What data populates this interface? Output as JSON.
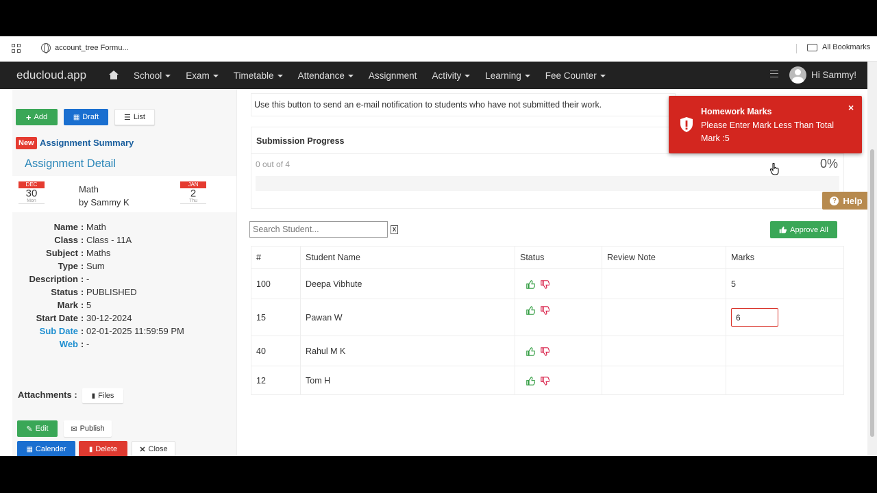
{
  "bookmarks": {
    "tab_label": "account_tree Formu...",
    "all_bookmarks": "All Bookmarks"
  },
  "navbar": {
    "brand": "educloud.app",
    "items": [
      {
        "label": "School",
        "dropdown": true
      },
      {
        "label": "Exam",
        "dropdown": true
      },
      {
        "label": "Timetable",
        "dropdown": true
      },
      {
        "label": "Attendance",
        "dropdown": true
      },
      {
        "label": "Assignment",
        "dropdown": false
      },
      {
        "label": "Activity",
        "dropdown": true
      },
      {
        "label": "Learning",
        "dropdown": true
      },
      {
        "label": "Fee Counter",
        "dropdown": true
      }
    ],
    "greeting": "Hi Sammy!"
  },
  "left": {
    "add_label": "Add",
    "draft_label": "Draft",
    "list_label": "List",
    "new_badge": "New",
    "summary_title": "Assignment Summary",
    "detail_title": "Assignment Detail",
    "start_cal": {
      "month": "DEC",
      "day": "30",
      "weekday": "Mon"
    },
    "end_cal": {
      "month": "JAN",
      "day": "2",
      "weekday": "Thu"
    },
    "subject_name": "Math",
    "by_line": "by Sammy K",
    "fields": [
      {
        "key": "Name",
        "value": "Math"
      },
      {
        "key": "Class",
        "value": "Class - 11A"
      },
      {
        "key": "Subject",
        "value": "Maths"
      },
      {
        "key": "Type",
        "value": "Sum"
      },
      {
        "key": "Description",
        "value": "-"
      },
      {
        "key": "Status",
        "value": "PUBLISHED"
      },
      {
        "key": "Mark",
        "value": "5"
      },
      {
        "key": "Start Date",
        "value": "30-12-2024"
      },
      {
        "key": "Sub Date",
        "value": "02-01-2025 11:59:59 PM"
      },
      {
        "key": "Web",
        "value": "-"
      }
    ],
    "attachments_label": "Attachments :",
    "files_label": "Files",
    "edit_label": "Edit",
    "publish_label": "Publish",
    "calender_label": "Calender",
    "delete_label": "Delete",
    "close_label": "Close"
  },
  "main": {
    "notice": "Use this button to send an e-mail notification to students who have not submitted their work.",
    "progress_title": "Submission Progress",
    "progress_text": "0 out of 4",
    "progress_pct": "0%",
    "progress_fraction": 0,
    "search_placeholder": "Search Student...",
    "approve_all": "Approve All",
    "help_label": "Help",
    "table": {
      "headers": [
        "#",
        "Student Name",
        "Status",
        "Review Note",
        "Marks"
      ],
      "rows": [
        {
          "num": "100",
          "name": "Deepa Vibhute",
          "note": "",
          "marks": "5"
        },
        {
          "num": "15",
          "name": "Pawan W",
          "note": "",
          "marks": "6"
        },
        {
          "num": "40",
          "name": "Rahul M K",
          "note": "",
          "marks": ""
        },
        {
          "num": "12",
          "name": "Tom H",
          "note": "",
          "marks": ""
        }
      ]
    }
  },
  "toast": {
    "title": "Homework Marks",
    "message": "Please Enter Mark Less Than Total Mark :5",
    "close": "×"
  },
  "colors": {
    "navbar": "#222222",
    "green": "#3aa757",
    "blue": "#1a6fd0",
    "red": "#df3a30",
    "toast": "#d3261f",
    "help": "#b78a4e"
  }
}
